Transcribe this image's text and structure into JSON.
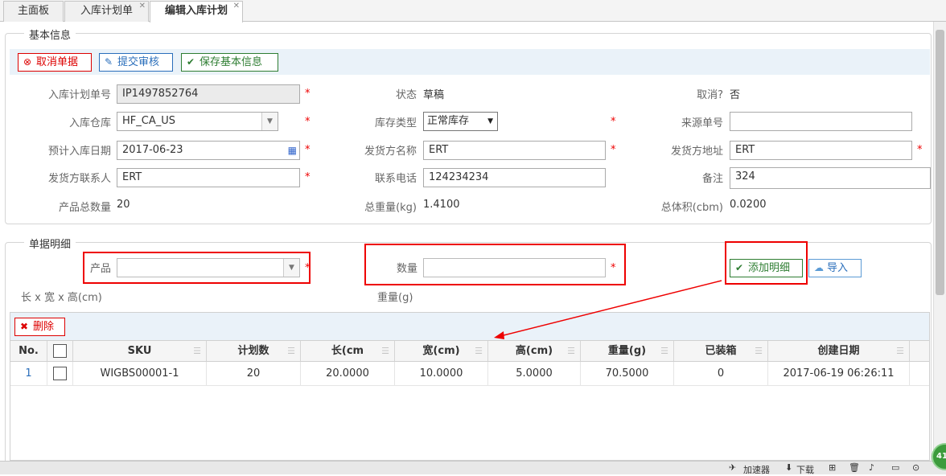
{
  "tabs": [
    {
      "label": "主面板",
      "closable": false
    },
    {
      "label": "入库计划单",
      "closable": true
    },
    {
      "label": "编辑入库计划",
      "closable": true
    }
  ],
  "basic": {
    "legend": "基本信息",
    "buttons": {
      "cancel": "取消单据",
      "submit": "提交审核",
      "save": "保存基本信息"
    },
    "fields": {
      "plan_no": {
        "label": "入库计划单号",
        "value": "IP1497852764"
      },
      "status": {
        "label": "状态",
        "value": "草稿"
      },
      "cancelled": {
        "label": "取消?",
        "value": "否"
      },
      "warehouse": {
        "label": "入库仓库",
        "value": "HF_CA_US"
      },
      "stock_type": {
        "label": "库存类型",
        "value": "正常库存"
      },
      "source_no": {
        "label": "来源单号",
        "value": ""
      },
      "est_date": {
        "label": "预计入库日期",
        "value": "2017-06-23"
      },
      "shipper_name": {
        "label": "发货方名称",
        "value": "ERT"
      },
      "shipper_addr": {
        "label": "发货方地址",
        "value": "ERT"
      },
      "shipper_contact": {
        "label": "发货方联系人",
        "value": "ERT"
      },
      "phone": {
        "label": "联系电话",
        "value": "124234234"
      },
      "remark": {
        "label": "备注",
        "value": "324"
      },
      "total_qty": {
        "label": "产品总数量",
        "value": "20"
      },
      "total_weight": {
        "label": "总重量(kg)",
        "value": "1.4100"
      },
      "total_volume": {
        "label": "总体积(cbm)",
        "value": "0.0200"
      }
    },
    "required_mark": "*"
  },
  "detail": {
    "legend": "单据明细",
    "product_label": "产品",
    "qty_label": "数量",
    "dims_label": "长 x 宽 x 高(cm)",
    "weight_label": "重量(g)",
    "add_button": "添加明细",
    "import_button": "导入",
    "delete_button": "删除"
  },
  "grid": {
    "columns": [
      "No.",
      "",
      "SKU",
      "计划数",
      "长(cm",
      "宽(cm)",
      "高(cm)",
      "重量(g)",
      "已装箱",
      "创建日期"
    ],
    "rows": [
      [
        "1",
        "",
        "WIGBS00001-1",
        "20",
        "20.0000",
        "10.0000",
        "5.0000",
        "70.5000",
        "0",
        "2017-06-19 06:26:11"
      ]
    ]
  },
  "statusbar": {
    "accelerator": "加速器",
    "download": "下载",
    "badge": "41"
  },
  "colors": {
    "annotation_red": "#e00000",
    "accent_green": "#2e7d32",
    "toolbar_bg": "#eaf2f9"
  }
}
